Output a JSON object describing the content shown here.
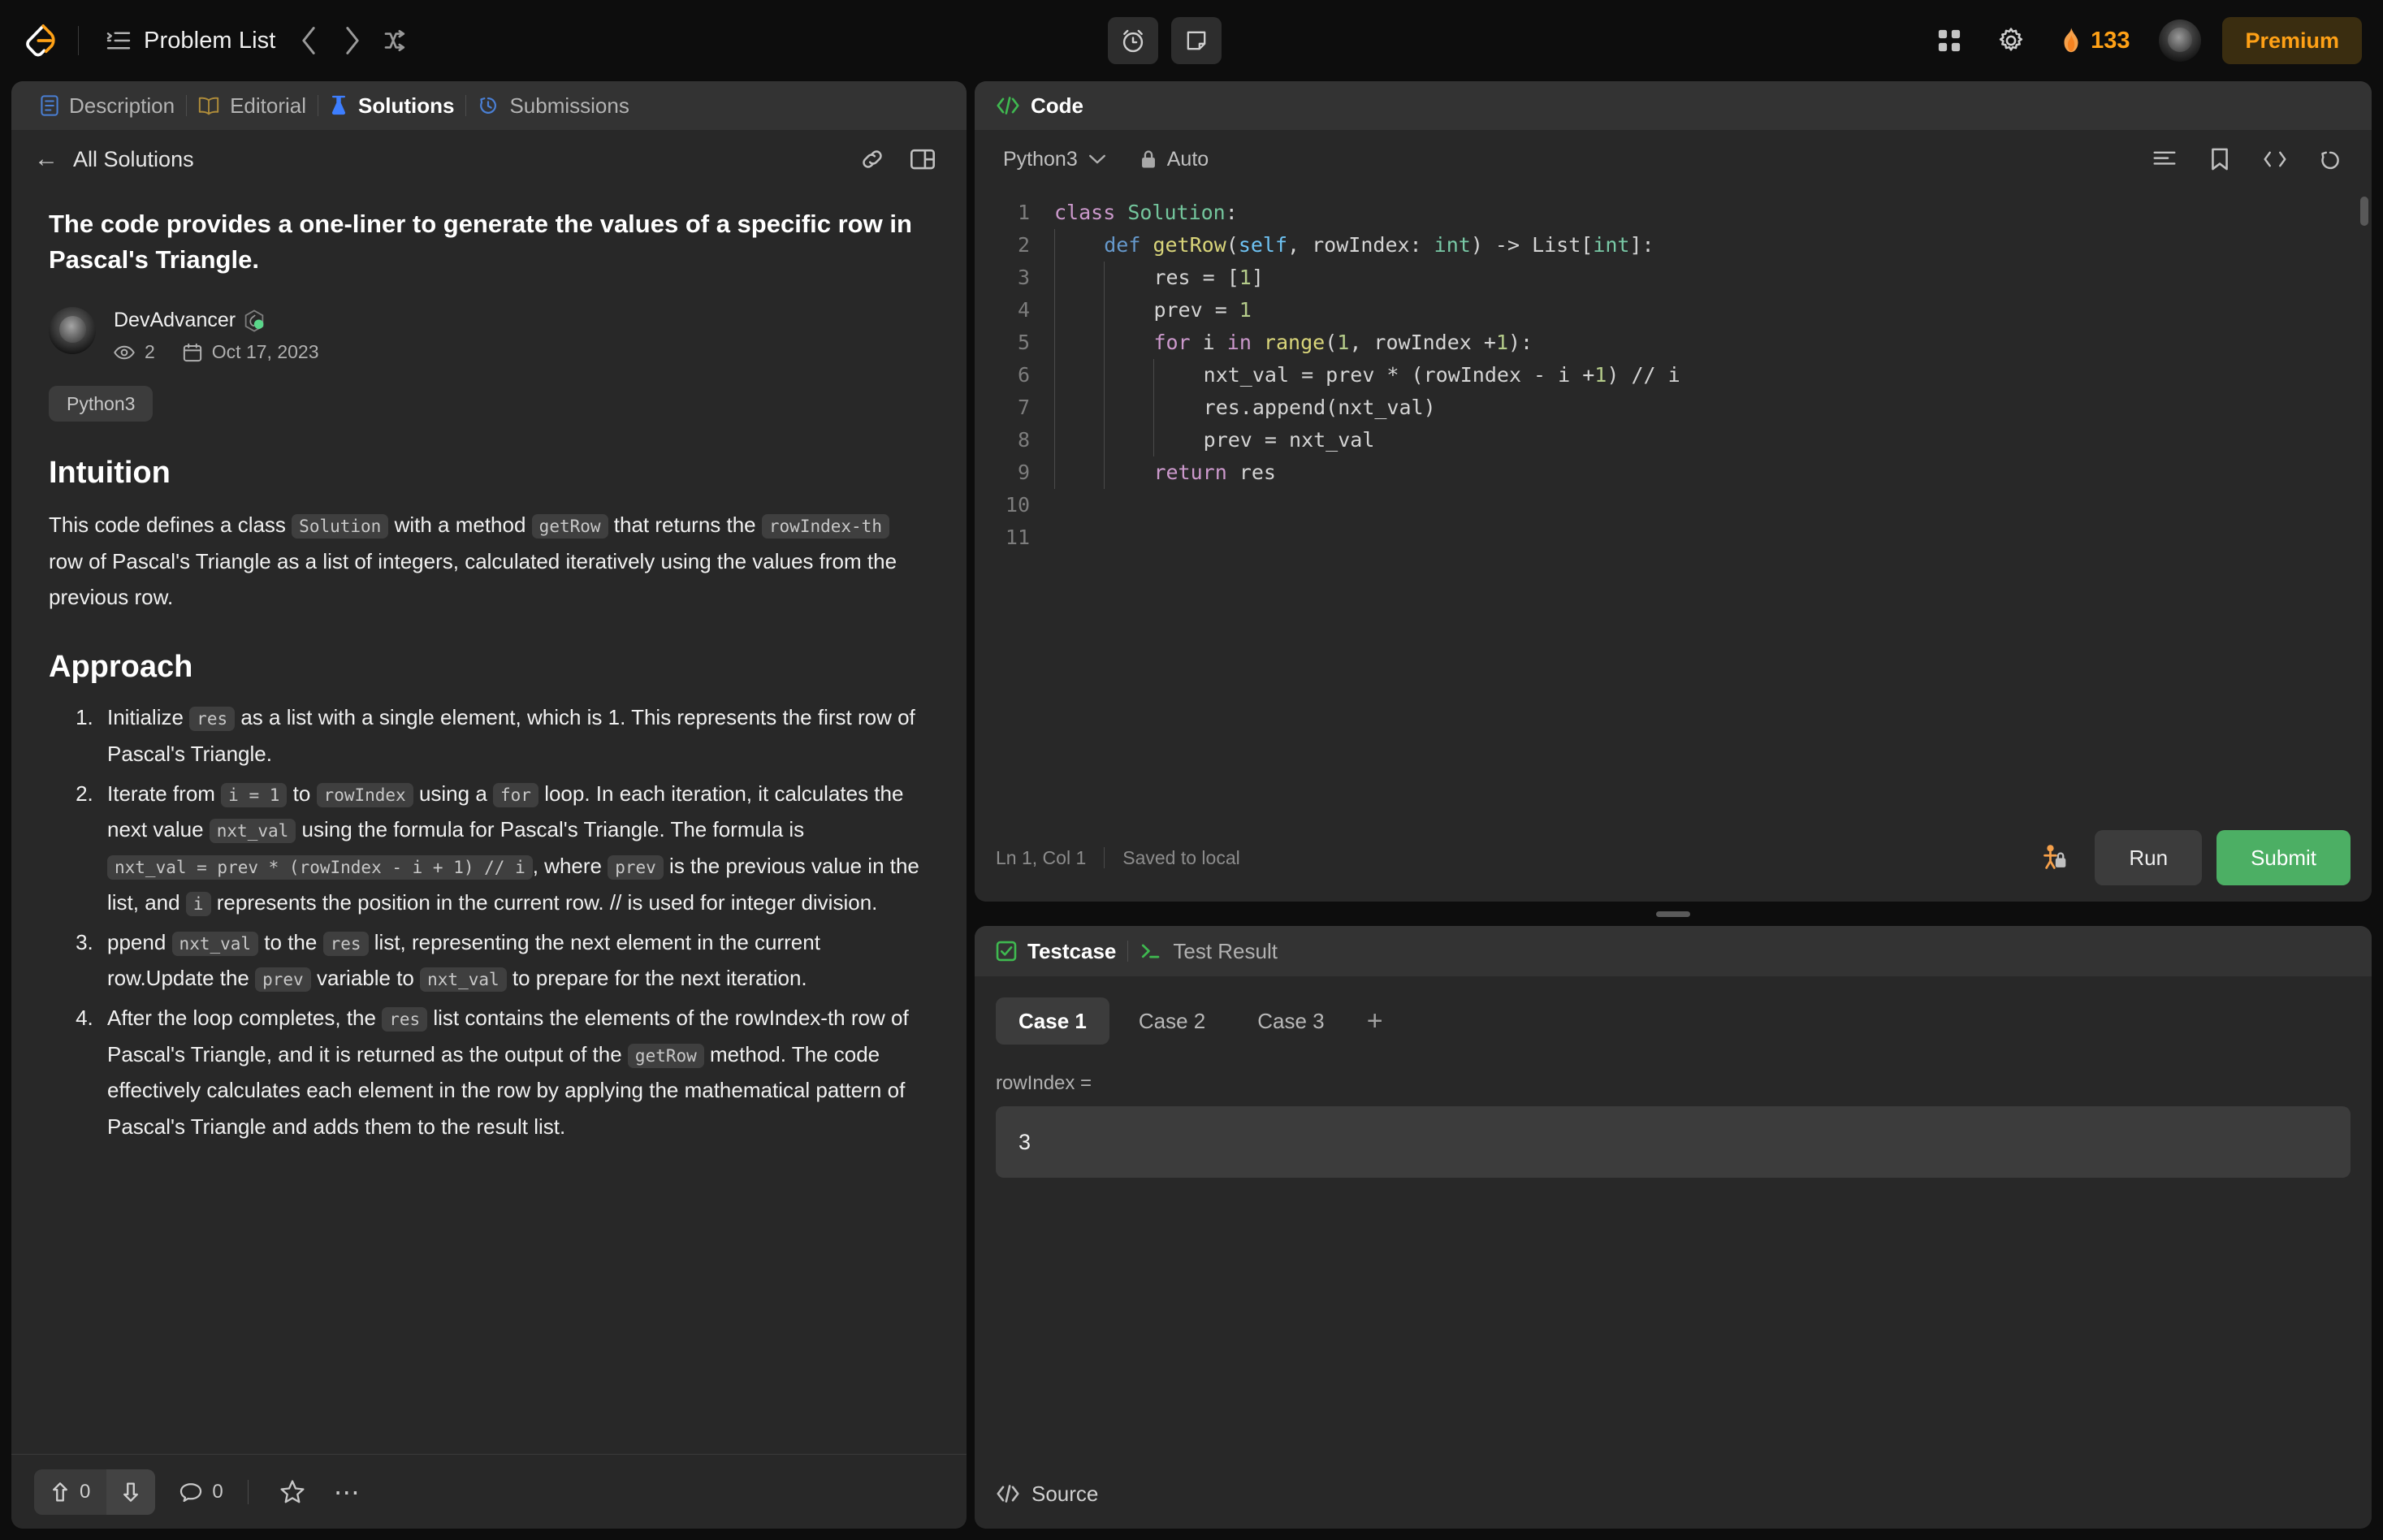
{
  "topnav": {
    "logo_name": "leetcode-logo",
    "problem_list_label": "Problem List",
    "prev_label": "‹",
    "next_label": "›",
    "streak_count": "133",
    "premium_label": "Premium"
  },
  "left_panel": {
    "tabs": [
      {
        "label": "Description",
        "icon": "description-icon",
        "active": false
      },
      {
        "label": "Editorial",
        "icon": "editorial-icon",
        "active": false
      },
      {
        "label": "Solutions",
        "icon": "solutions-flask-icon",
        "active": true
      },
      {
        "label": "Submissions",
        "icon": "submissions-history-icon",
        "active": false
      }
    ],
    "back_label": "All Solutions",
    "solution": {
      "title": "The code provides a one-liner to generate the values of a specific row in Pascal's Triangle.",
      "author": "DevAdvancer",
      "views": "2",
      "date": "Oct 17, 2023",
      "language_tag": "Python3"
    },
    "intuition": {
      "heading": "Intuition",
      "p1_a": "This code defines a class",
      "p1_code1": "Solution",
      "p1_b": "with a method",
      "p1_code2": "getRow",
      "p1_c": "that returns the",
      "p1_code3": "rowIndex-th",
      "p1_d": "row of Pascal's Triangle as a list of integers, calculated iteratively using the values from the previous row."
    },
    "approach": {
      "heading": "Approach",
      "item1": {
        "a": "Initialize",
        "code1": "res",
        "b": "as a list with a single element, which is 1. This represents the first row of Pascal's Triangle."
      },
      "item2": {
        "a": "Iterate from",
        "code1": "i = 1",
        "b": "to",
        "code2": "rowIndex",
        "c": "using a",
        "code3": "for",
        "d": "loop. In each iteration, it calculates the next value",
        "code4": "nxt_val",
        "e": "using the formula for Pascal's Triangle. The formula is",
        "code5": "nxt_val = prev * (rowIndex - i + 1) // i",
        "f": ", where",
        "code6": "prev",
        "g": "is the previous value in the list, and",
        "code7": "i",
        "h": "represents the position in the current row. // is used for integer division."
      },
      "item3": {
        "a": "ppend",
        "code1": "nxt_val",
        "b": "to the",
        "code2": "res",
        "c": "list, representing the next element in the current row.Update the",
        "code3": "prev",
        "d": "variable to",
        "code4": "nxt_val",
        "e": "to prepare for the next iteration."
      },
      "item4": {
        "a": "After the loop completes, the",
        "code1": "res",
        "b": "list contains the elements of the rowIndex-th row of Pascal's Triangle, and it is returned as the output of the",
        "code2": "getRow",
        "c": "method. The code effectively calculates each element in the row by applying the mathematical pattern of Pascal's Triangle and adds them to the result list."
      }
    },
    "footer": {
      "upvotes": "0",
      "comments": "0"
    }
  },
  "code_panel": {
    "tab_label": "Code",
    "language": "Python3",
    "auto_label": "Auto",
    "lines": [
      {
        "n": "1",
        "indents": 0,
        "tokens": [
          {
            "t": "class ",
            "c": "k-kw"
          },
          {
            "t": "Solution",
            "c": "k-cls"
          },
          {
            "t": ":",
            "c": "k-plain"
          }
        ]
      },
      {
        "n": "2",
        "indents": 1,
        "tokens": [
          {
            "t": "def ",
            "c": "k-def"
          },
          {
            "t": "getRow",
            "c": "k-fn"
          },
          {
            "t": "(",
            "c": "k-plain"
          },
          {
            "t": "self",
            "c": "k-param"
          },
          {
            "t": ", rowIndex: ",
            "c": "k-plain"
          },
          {
            "t": "int",
            "c": "k-type"
          },
          {
            "t": ") -> List[",
            "c": "k-plain"
          },
          {
            "t": "int",
            "c": "k-type"
          },
          {
            "t": "]:",
            "c": "k-plain"
          }
        ]
      },
      {
        "n": "3",
        "indents": 2,
        "tokens": [
          {
            "t": "res = [",
            "c": "k-plain"
          },
          {
            "t": "1",
            "c": "k-num"
          },
          {
            "t": "]",
            "c": "k-plain"
          }
        ]
      },
      {
        "n": "4",
        "indents": 2,
        "tokens": [
          {
            "t": "prev = ",
            "c": "k-plain"
          },
          {
            "t": "1",
            "c": "k-num"
          }
        ]
      },
      {
        "n": "5",
        "indents": 2,
        "tokens": [
          {
            "t": "for ",
            "c": "k-kw"
          },
          {
            "t": "i ",
            "c": "k-plain"
          },
          {
            "t": "in ",
            "c": "k-kw"
          },
          {
            "t": "range",
            "c": "k-fn"
          },
          {
            "t": "(",
            "c": "k-plain"
          },
          {
            "t": "1",
            "c": "k-num"
          },
          {
            "t": ", rowIndex +",
            "c": "k-plain"
          },
          {
            "t": "1",
            "c": "k-num"
          },
          {
            "t": "):",
            "c": "k-plain"
          }
        ]
      },
      {
        "n": "6",
        "indents": 3,
        "tokens": [
          {
            "t": "nxt_val = prev * (rowIndex - i +",
            "c": "k-plain"
          },
          {
            "t": "1",
            "c": "k-num"
          },
          {
            "t": ") // i",
            "c": "k-plain"
          }
        ]
      },
      {
        "n": "7",
        "indents": 3,
        "tokens": [
          {
            "t": "res.append(nxt_val)",
            "c": "k-plain"
          }
        ]
      },
      {
        "n": "8",
        "indents": 3,
        "tokens": [
          {
            "t": "prev = nxt_val",
            "c": "k-plain"
          }
        ]
      },
      {
        "n": "9",
        "indents": 2,
        "tokens": [
          {
            "t": "return ",
            "c": "k-kw"
          },
          {
            "t": "res",
            "c": "k-plain"
          }
        ]
      },
      {
        "n": "10",
        "indents": 0,
        "tokens": []
      },
      {
        "n": "11",
        "indents": 0,
        "tokens": []
      }
    ],
    "status_position": "Ln 1, Col 1",
    "status_saved": "Saved to local",
    "run_label": "Run",
    "submit_label": "Submit"
  },
  "test_panel": {
    "tabs": [
      {
        "label": "Testcase",
        "icon": "testcase-check-icon",
        "active": true
      },
      {
        "label": "Test Result",
        "icon": "test-result-terminal-icon",
        "active": false
      }
    ],
    "cases": [
      {
        "label": "Case 1",
        "active": true
      },
      {
        "label": "Case 2",
        "active": false
      },
      {
        "label": "Case 3",
        "active": false
      }
    ],
    "add_case_label": "+",
    "param_label": "rowIndex =",
    "param_value": "3",
    "source_label": "Source"
  },
  "colors": {
    "accent_orange": "#ffa116",
    "submit_green": "#4caf64",
    "panel_bg": "#282828",
    "tabbar_bg": "#333333"
  }
}
